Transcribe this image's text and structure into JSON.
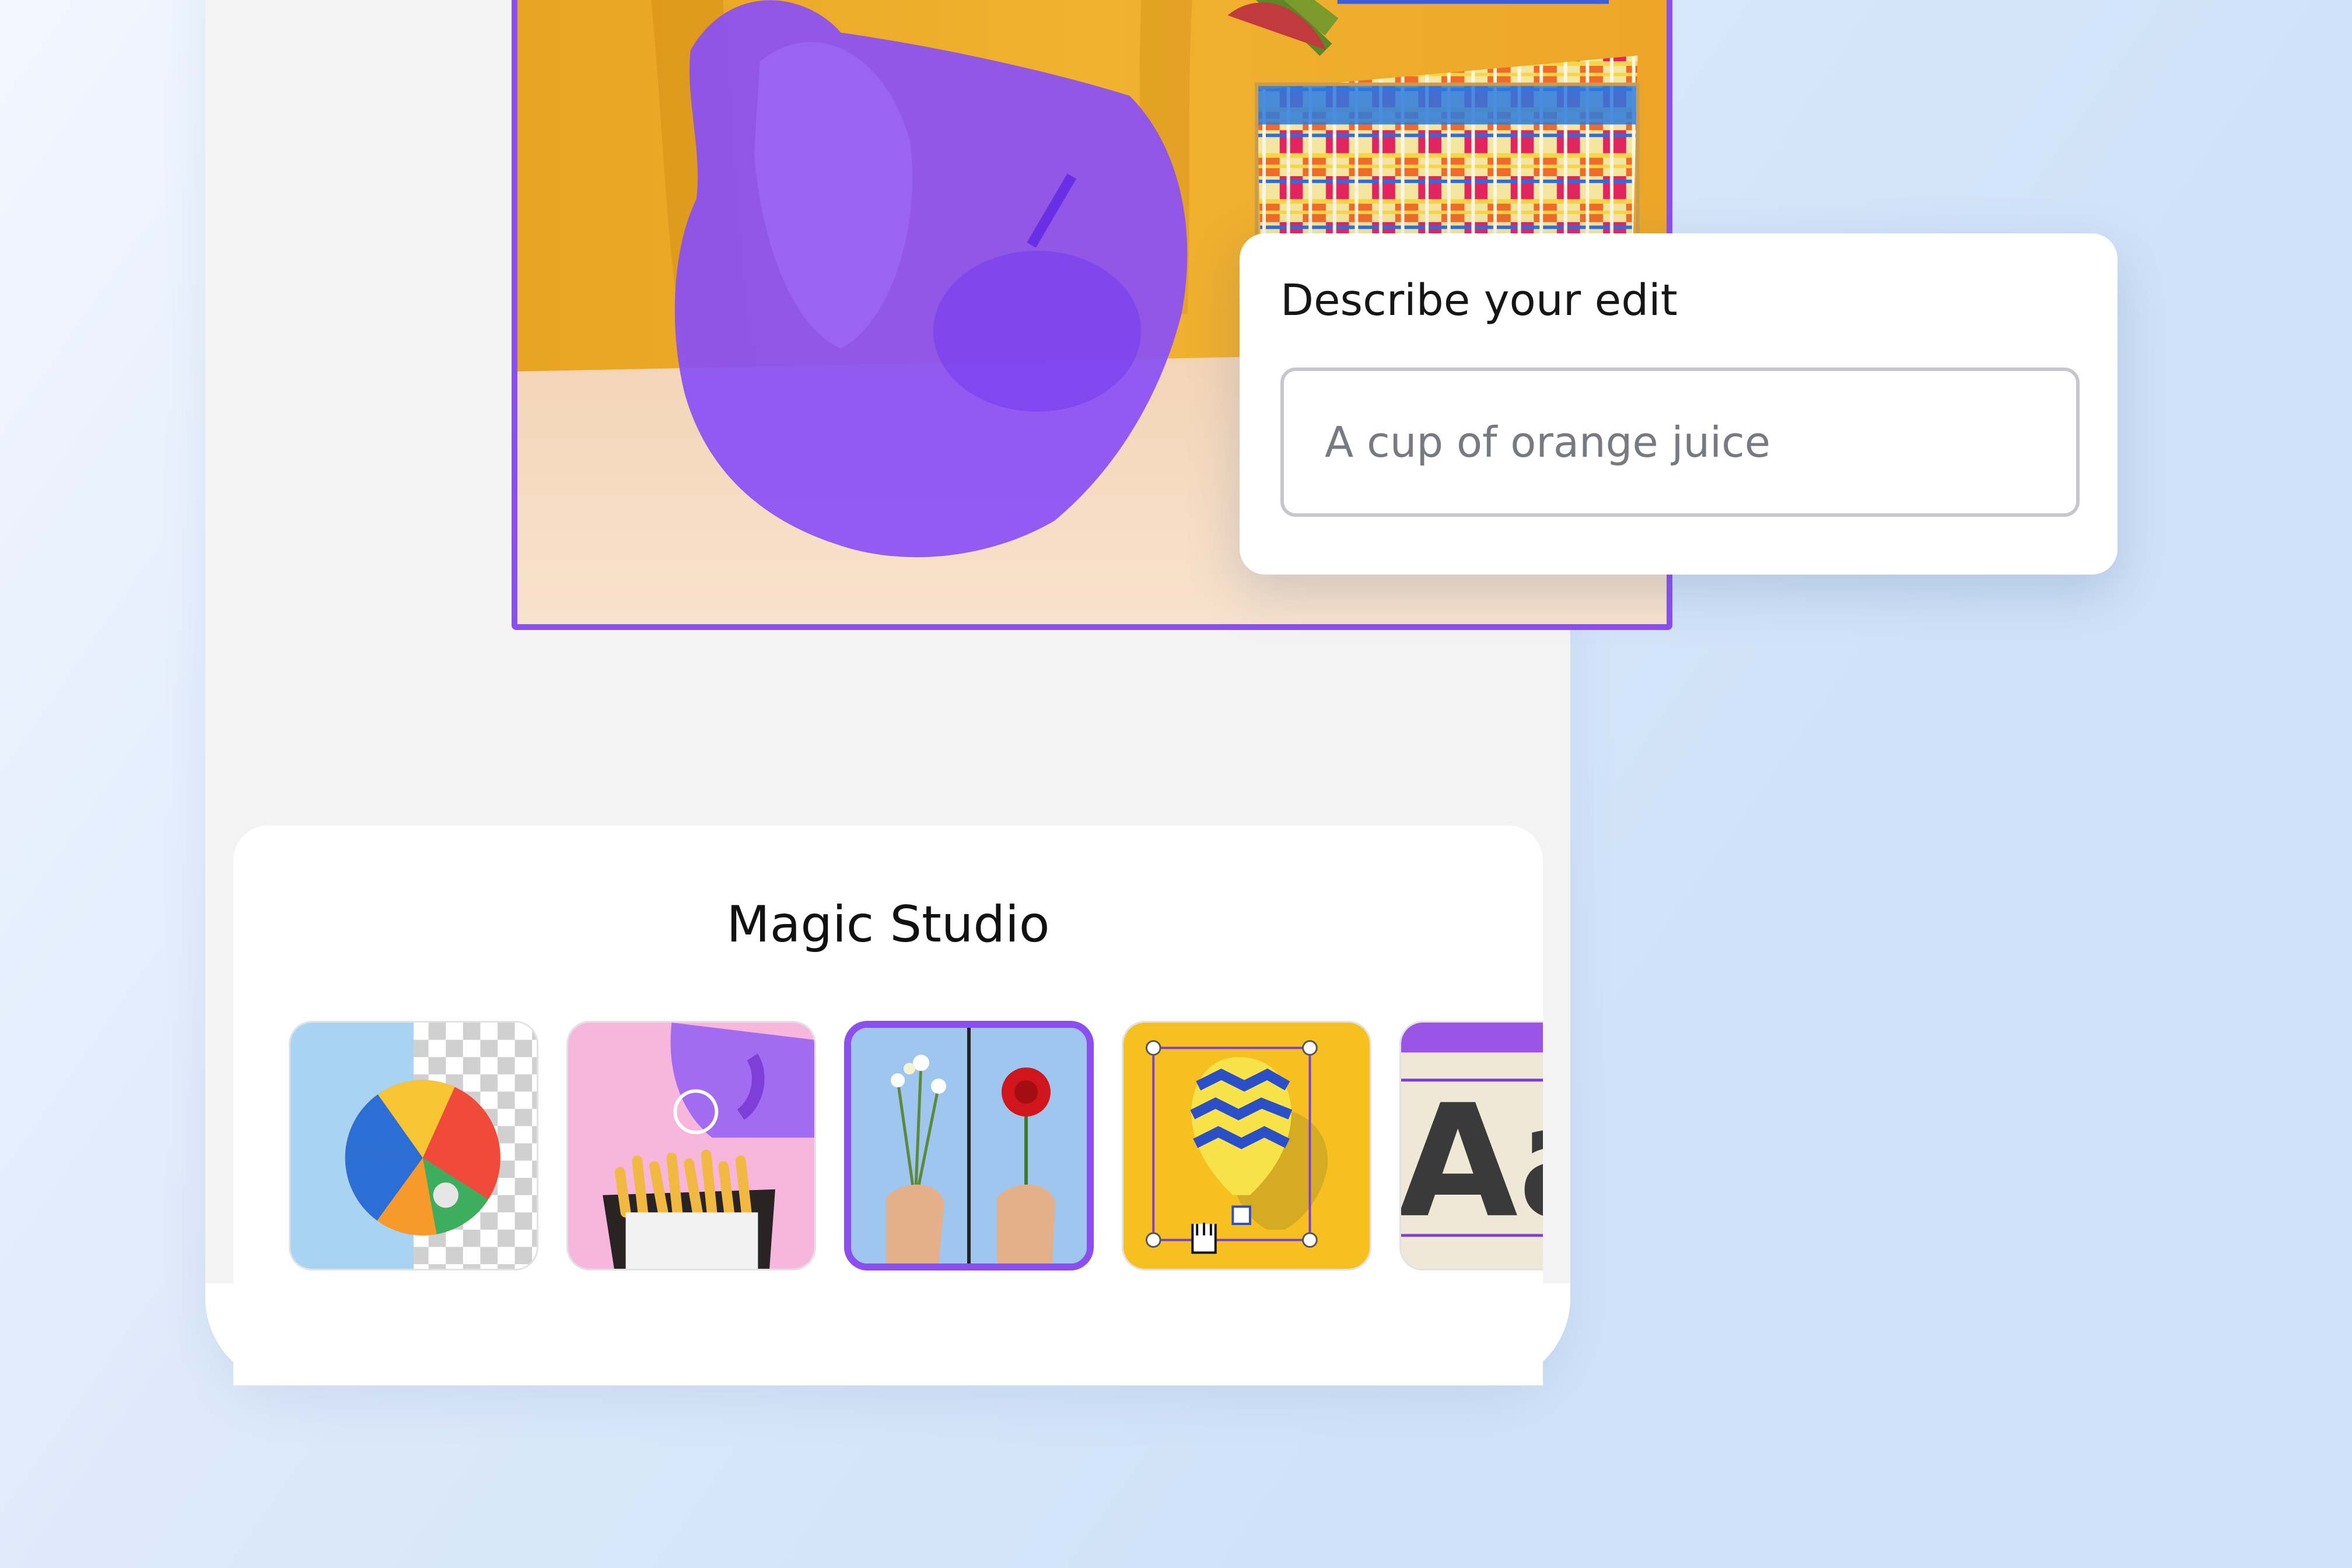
{
  "edit_panel": {
    "label": "Describe your edit",
    "input_placeholder": "A cup of orange juice",
    "input_value": ""
  },
  "studio": {
    "title": "Magic Studio",
    "tools": [
      {
        "icon": "beach-ball-background-remover-icon",
        "selected": false
      },
      {
        "icon": "fries-magic-grab-icon",
        "selected": false
      },
      {
        "icon": "flowers-magic-edit-icon",
        "selected": true
      },
      {
        "icon": "balloon-magic-expand-icon",
        "selected": false
      },
      {
        "icon": "text-aa-icon",
        "selected": false
      }
    ],
    "text_tile_glyph": "Aa"
  },
  "colors": {
    "accent": "#8b4ff0",
    "photo_backdrop": "#f2b232",
    "selection_overlay": "#8a4ff5"
  }
}
